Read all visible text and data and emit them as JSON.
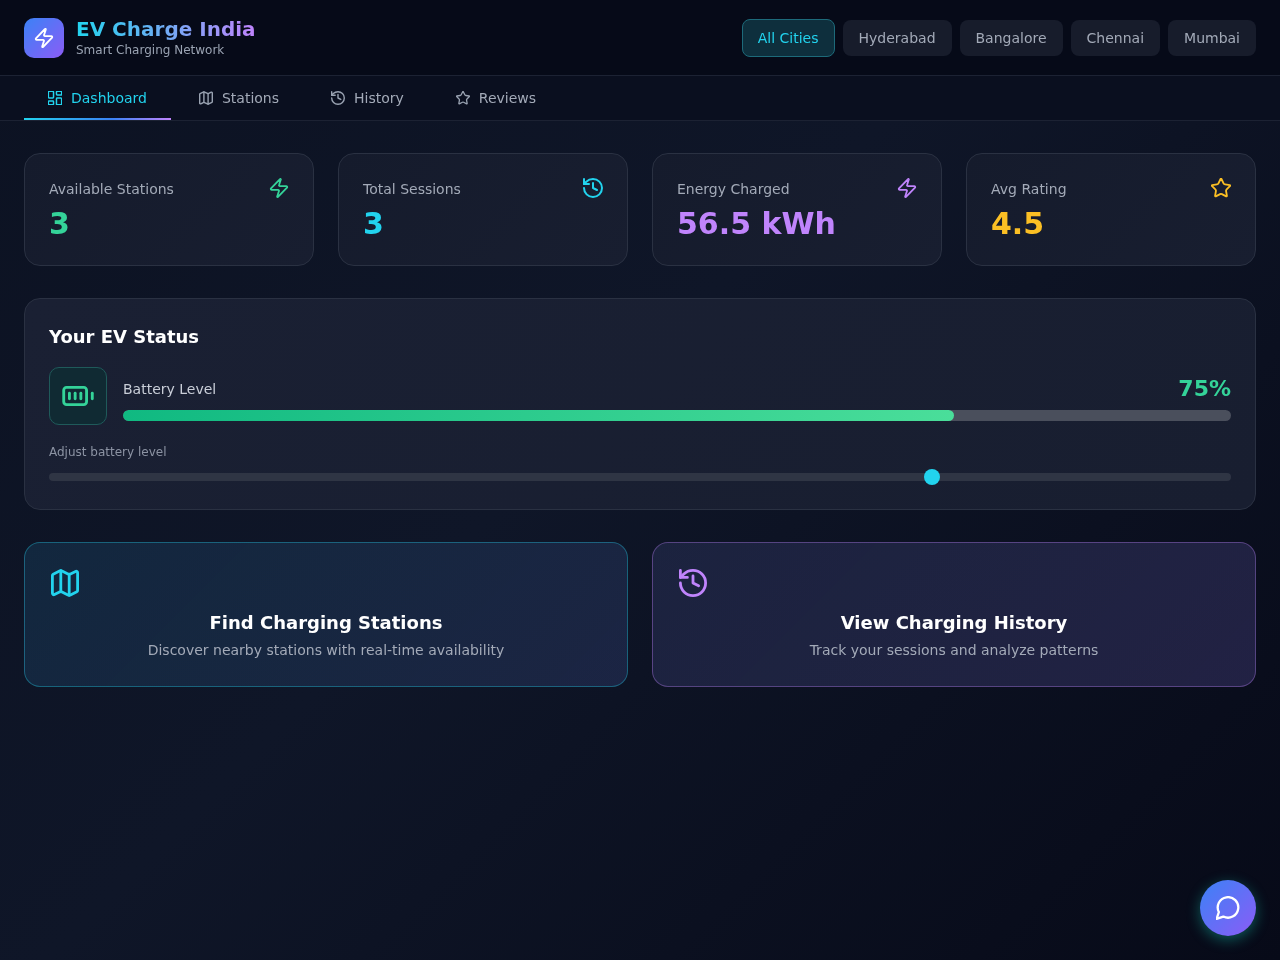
{
  "brand": {
    "title": "EV Charge India",
    "subtitle": "Smart Charging Network"
  },
  "city_filters": [
    {
      "label": "All Cities",
      "selected": true
    },
    {
      "label": "Hyderabad",
      "selected": false
    },
    {
      "label": "Bangalore",
      "selected": false
    },
    {
      "label": "Chennai",
      "selected": false
    },
    {
      "label": "Mumbai",
      "selected": false
    }
  ],
  "tabs": [
    {
      "label": "Dashboard",
      "kind": "dashboard",
      "selected": true
    },
    {
      "label": "Stations",
      "kind": "map",
      "selected": false
    },
    {
      "label": "History",
      "kind": "history",
      "selected": false
    },
    {
      "label": "Reviews",
      "kind": "star",
      "selected": false
    }
  ],
  "stats": [
    {
      "label": "Available Stations",
      "value": "3",
      "kind": "bolt",
      "color": "#34d399"
    },
    {
      "label": "Total Sessions",
      "value": "3",
      "kind": "history",
      "color": "#22d3ee"
    },
    {
      "label": "Energy Charged",
      "value": "56.5 kWh",
      "kind": "bolt",
      "color": "#c084fc"
    },
    {
      "label": "Avg Rating",
      "value": "4.5",
      "kind": "star",
      "color": "#fbbf24"
    }
  ],
  "ev_status": {
    "title": "Your EV Status",
    "battery": {
      "label": "Battery Level",
      "reading": "75%",
      "level": 0.75
    },
    "slider": {
      "label": "Adjust battery level",
      "level": 0.747
    }
  },
  "action_cards": [
    {
      "title": "Find Charging Stations",
      "description": "Discover nearby stations with real-time availability",
      "kind": "map",
      "color": "#22d3ee"
    },
    {
      "title": "View Charging History",
      "description": "Track your sessions and analyze patterns",
      "kind": "history",
      "color": "#c084fc"
    }
  ]
}
